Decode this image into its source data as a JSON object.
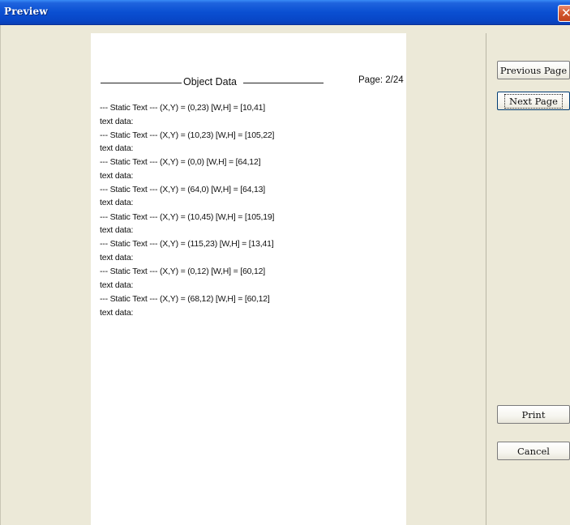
{
  "window": {
    "title": "Preview",
    "close_symbol": "✕"
  },
  "report": {
    "heading": "Object Data",
    "page_label": "Page: 2/24",
    "lines": [
      "--- Static Text --- (X,Y) = (0,23)      [W,H] = [10,41]",
      "text data:",
      "--- Static Text --- (X,Y) = (10,23)      [W,H] = [105,22]",
      "text data:",
      "--- Static Text --- (X,Y) = (0,0)      [W,H] = [64,12]",
      "text data:",
      "--- Static Text --- (X,Y) = (64,0)      [W,H] = [64,13]",
      "text data:",
      "--- Static Text --- (X,Y) = (10,45)      [W,H] = [105,19]",
      "text data:",
      "--- Static Text --- (X,Y) = (115,23)      [W,H] = [13,41]",
      "text data:",
      "--- Static Text --- (X,Y) = (0,12)      [W,H] = [60,12]",
      "text data:",
      "--- Static Text --- (X,Y) = (68,12)      [W,H] = [60,12]",
      "text data:"
    ]
  },
  "buttons": {
    "previous_page": "Previous Page",
    "next_page": "Next Page",
    "print": "Print",
    "cancel": "Cancel"
  }
}
